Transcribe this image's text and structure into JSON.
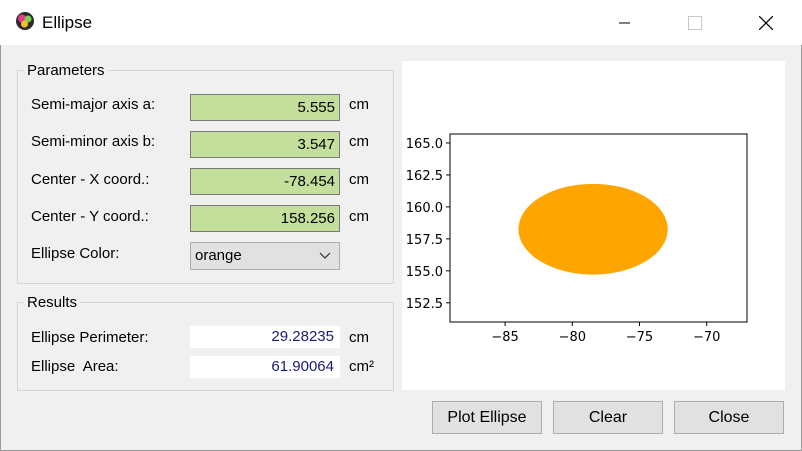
{
  "window": {
    "title": "Ellipse"
  },
  "parameters": {
    "title": "Parameters",
    "rows": [
      {
        "label": "Semi-major axis a:",
        "value": "5.555",
        "unit": "cm"
      },
      {
        "label": "Semi-minor axis b:",
        "value": "3.547",
        "unit": "cm"
      },
      {
        "label": "Center - X coord.:",
        "value": "-78.454",
        "unit": "cm"
      },
      {
        "label": "Center - Y coord.:",
        "value": "158.256",
        "unit": "cm"
      }
    ],
    "color_label": "Ellipse Color:",
    "color_value": "orange"
  },
  "results": {
    "title": "Results",
    "perimeter": {
      "label": "Ellipse Perimeter:",
      "value": "29.28235",
      "unit": "cm"
    },
    "area": {
      "label": "Ellipse  Area:",
      "value": "61.90064",
      "unit": "cm²"
    }
  },
  "buttons": {
    "plot": "Plot Ellipse",
    "clear": "Clear",
    "close": "Close"
  },
  "chart_data": {
    "type": "scatter",
    "shape": "ellipse",
    "ellipse": {
      "cx": -78.454,
      "cy": 158.256,
      "a": 5.555,
      "b": 3.547,
      "color": "#FFA500"
    },
    "xlim": [
      -89.1,
      -67.0
    ],
    "ylim": [
      151.0,
      165.7
    ],
    "xticks": [
      -85,
      -80,
      -75,
      -70
    ],
    "xtick_labels": [
      "−85",
      "−80",
      "−75",
      "−70"
    ],
    "yticks": [
      152.5,
      155.0,
      157.5,
      160.0,
      162.5,
      165.0
    ],
    "ytick_labels": [
      "152.5",
      "155.0",
      "157.5",
      "160.0",
      "162.5",
      "165.0"
    ],
    "grid": false
  }
}
